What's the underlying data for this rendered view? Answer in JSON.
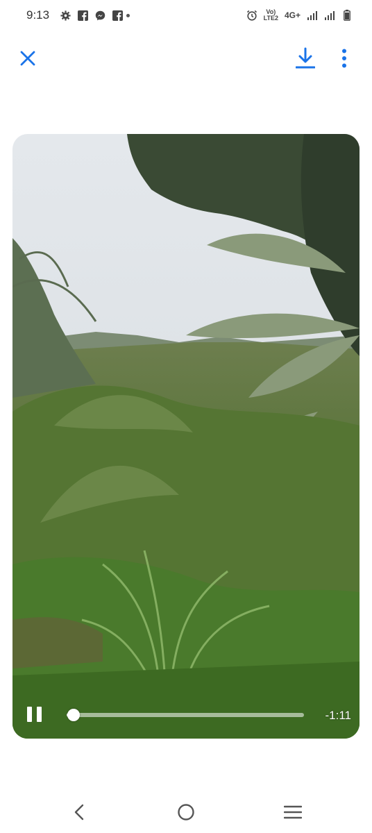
{
  "status_bar": {
    "time": "9:13",
    "left_icons": [
      "settings-icon",
      "facebook-icon",
      "messenger-icon",
      "facebook-icon",
      "dot-icon"
    ],
    "right_icons": [
      "alarm-icon",
      "volte-icon",
      "signal-icon",
      "signal-icon",
      "battery-icon"
    ],
    "volte_label_top": "Vo)",
    "volte_label_bottom": "LTE2",
    "network": "4G+"
  },
  "toolbar": {
    "close_icon": "close-icon",
    "download_icon": "download-icon",
    "more_icon": "more-vertical-icon",
    "accent_color": "#1a73e8"
  },
  "video": {
    "state_icon": "pause-icon",
    "progress": 0.03,
    "time_remaining": "-1:11"
  },
  "nav_bar": {
    "back_icon": "back-icon",
    "home_icon": "home-icon",
    "recents_icon": "recents-icon"
  }
}
